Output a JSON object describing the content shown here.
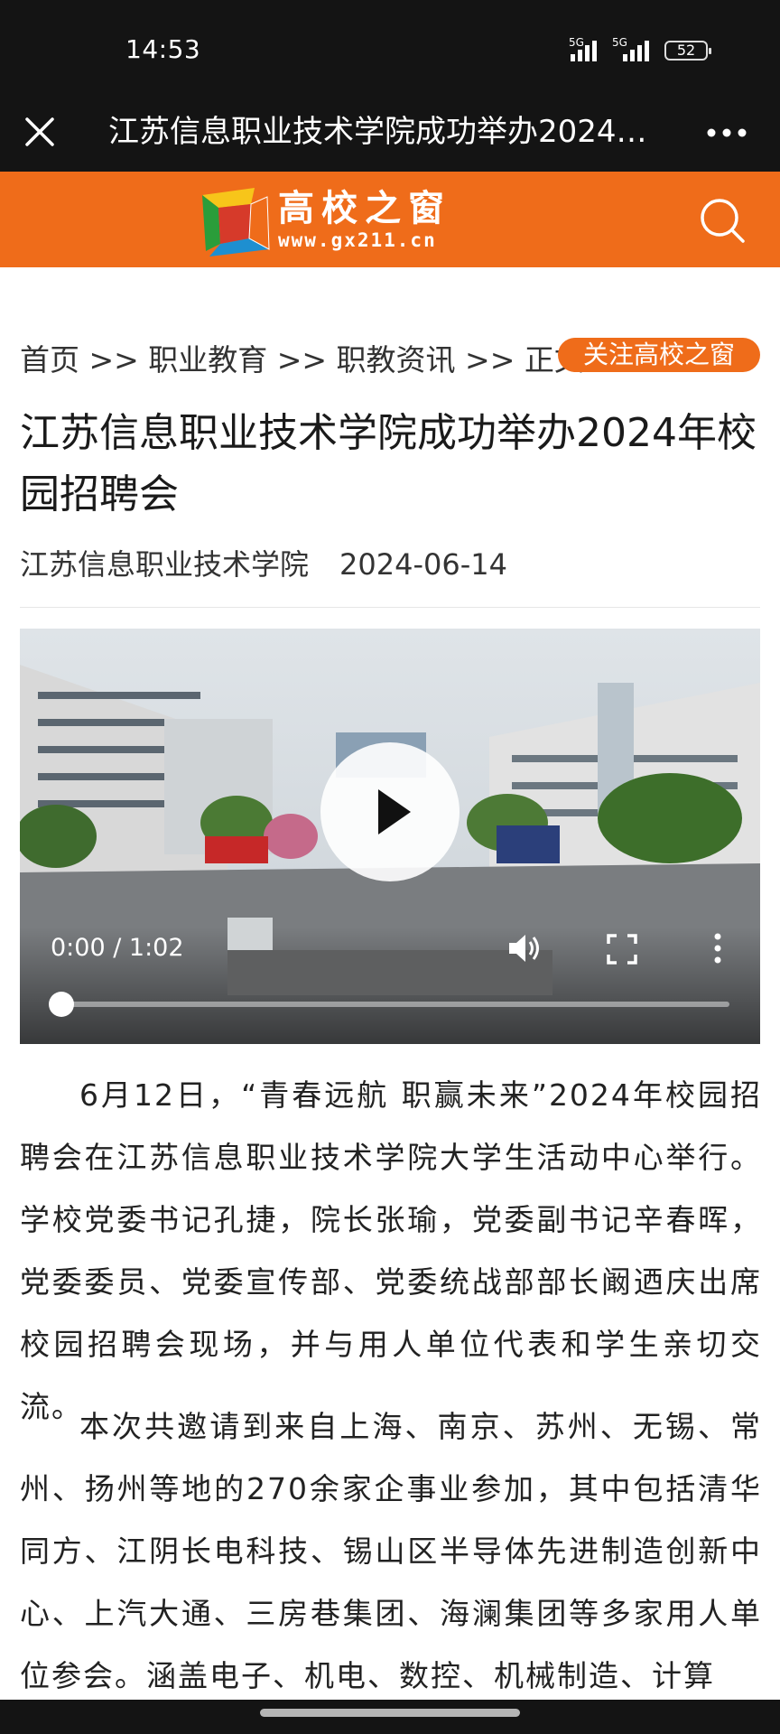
{
  "status_bar": {
    "time": "14:53",
    "signal_1": "5G",
    "signal_2": "5G",
    "battery": "52"
  },
  "title_bar": {
    "close_icon": "close-icon",
    "title": "江苏信息职业技术学院成功举办2024年校园招聘会",
    "more_icon": "more-horizontal-icon"
  },
  "site_header": {
    "brand_name": "高校之窗",
    "brand_url": "www.gx211.cn",
    "accent_color": "#ef6c1a",
    "search_icon": "search-icon"
  },
  "breadcrumb": {
    "text": "首页 >> 职业教育 >> 职教资讯 >> 正文",
    "follow_button": "关注高校之窗"
  },
  "article": {
    "headline": "江苏信息职业技术学院成功举办2024年校园招聘会",
    "source": "江苏信息职业技术学院",
    "date": "2024-06-14",
    "paragraph_1": "6月12日，“青春远航 职赢未来”2024年校园招聘会在江苏信息职业技术学院大学生活动中心举行。学校党委书记孔捷，院长张瑜，党委副书记辛春晖，党委委员、党委宣传部、党委统战部部长阚迺庆出席校园招聘会现场，并与用人单位代表和学生亲切交流。",
    "paragraph_2": "本次共邀请到来自上海、南京、苏州、无锡、常州、扬州等地的270余家企事业参加，其中包括清华同方、江阴长电科技、锡山区半导体先进制造创新中心、上汽大通、三房巷集团、海澜集团等多家用人单位参会。涵盖电子、机电、数控、机械制造、计算"
  },
  "video": {
    "time_display": "0:00 / 1:02",
    "progress": 0.0,
    "icons": [
      "play-icon",
      "volume-icon",
      "fullscreen-icon",
      "more-vertical-icon"
    ]
  }
}
